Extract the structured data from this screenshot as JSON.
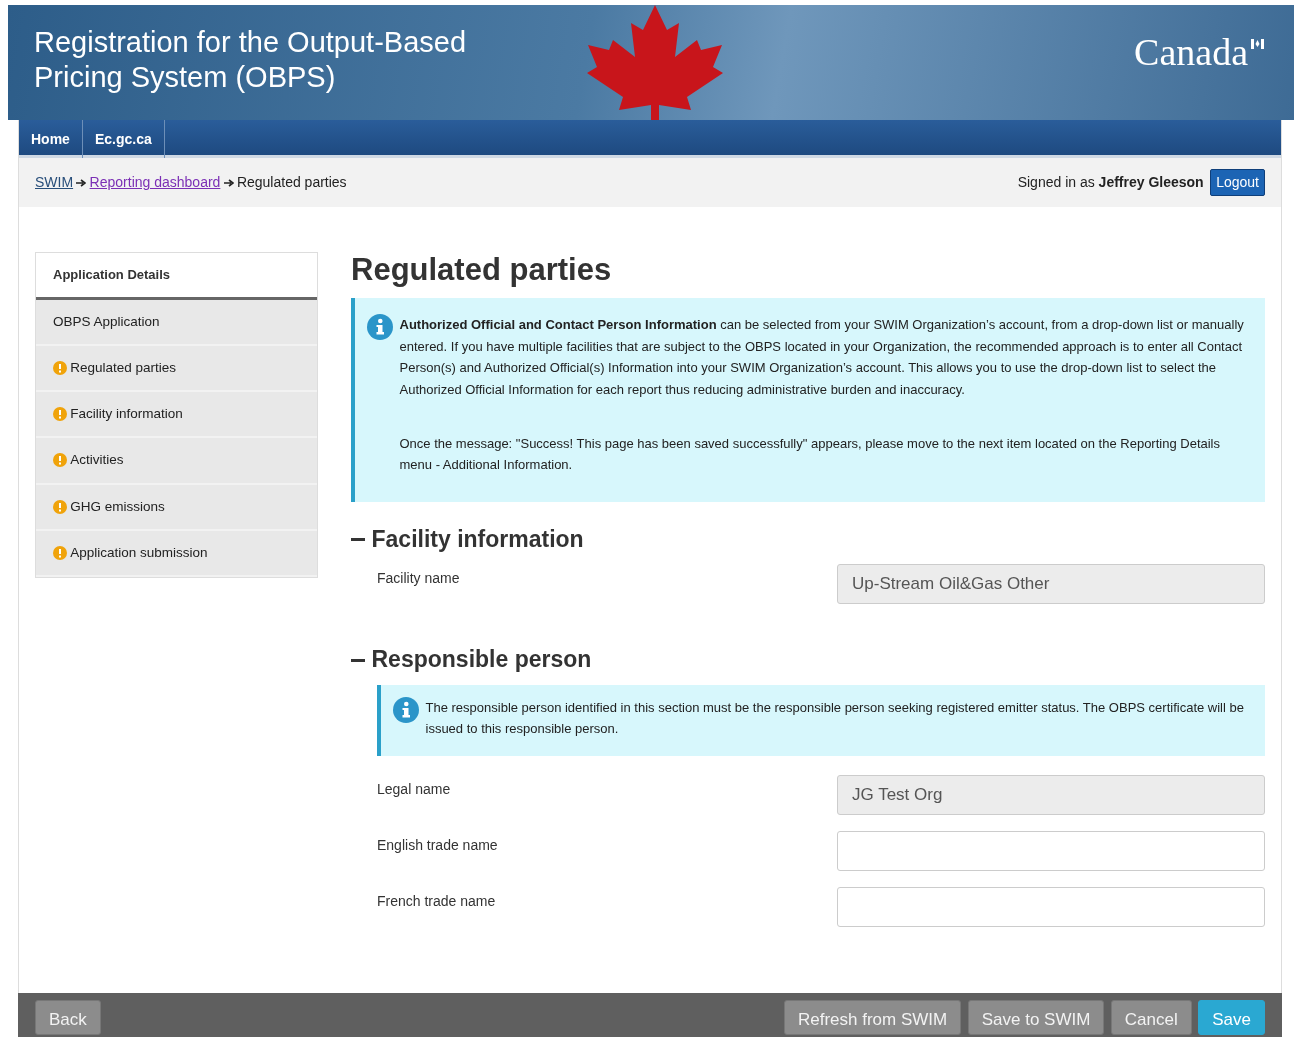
{
  "header": {
    "title": "Registration for the Output-Based Pricing System (OBPS)",
    "wordmark": "Canada"
  },
  "nav": [
    {
      "label": "Home"
    },
    {
      "label": "Ec.gc.ca"
    }
  ],
  "breadcrumb": [
    {
      "label": "SWIM",
      "kind": "link",
      "visited": false
    },
    {
      "label": "Reporting dashboard",
      "kind": "link",
      "visited": true
    },
    {
      "label": "Regulated parties",
      "kind": "current"
    }
  ],
  "user": {
    "signed_in_label": "Signed in as",
    "name": "Jeffrey Gleeson",
    "logout": "Logout"
  },
  "sidebar": {
    "heading": "Application Details",
    "items": [
      {
        "label": "OBPS Application",
        "warning": false
      },
      {
        "label": "Regulated parties",
        "warning": true
      },
      {
        "label": "Facility information",
        "warning": true
      },
      {
        "label": "Activities",
        "warning": true
      },
      {
        "label": "GHG emissions",
        "warning": true
      },
      {
        "label": "Application submission",
        "warning": true
      }
    ]
  },
  "page_title": "Regulated parties",
  "intro_alert": {
    "paragraphs": [
      "**Authorized Official and Contact Person Information** can be selected from your SWIM Organization’s account, from a drop-down list or manually entered. If you have multiple facilities that are subject to the OBPS located in your Organization, the recommended approach is to enter all Contact Person(s) and Authorized Official(s) Information into your SWIM Organization’s account. This allows you to use the drop-down list to select the Authorized Official Information for each report thus reducing administrative burden and inaccuracy.",
      "Once the message: \"Success! This page has been saved successfully\" appears, please move to the next item located on the Reporting Details menu - Additional Information."
    ]
  },
  "sections": [
    {
      "title": "Facility information",
      "expanded": true,
      "fields": [
        {
          "label": "Facility name",
          "value": "Up-Stream Oil&Gas Other",
          "readonly": true
        }
      ]
    },
    {
      "title": "Responsible person",
      "expanded": true,
      "note": "The responsible person identified in this section must be the responsible person seeking registered emitter status. The OBPS certificate will be issued to this responsible person.",
      "fields": [
        {
          "label": "Legal name",
          "value": "JG Test Org",
          "readonly": true
        },
        {
          "label": "English trade name",
          "readonly": false
        },
        {
          "label": "French trade name",
          "readonly": false
        }
      ]
    }
  ],
  "footer": {
    "left": [
      {
        "label": "Back",
        "kind": "default"
      }
    ],
    "right": [
      {
        "label": "Refresh from SWIM",
        "kind": "default"
      },
      {
        "label": "Save to SWIM",
        "kind": "default"
      },
      {
        "label": "Cancel",
        "kind": "default"
      },
      {
        "label": "Save",
        "kind": "primary"
      }
    ]
  }
}
